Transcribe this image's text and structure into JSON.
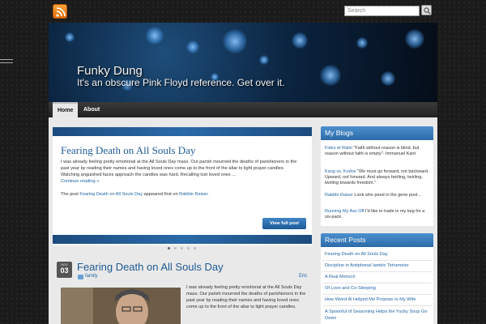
{
  "site": {
    "title": "Funky Dung",
    "tagline": "It's an obscure Pink Floyd reference. Get over it."
  },
  "search": {
    "placeholder": "Search"
  },
  "icons": {
    "rss": "rss-icon",
    "search": "search-icon",
    "category": "folder-icon"
  },
  "colors": {
    "accent": "#2a6aa8",
    "link": "#2467a8",
    "title": "#1f5b95"
  },
  "nav": {
    "items": [
      {
        "label": "Home"
      },
      {
        "label": "About"
      }
    ]
  },
  "featured": {
    "title": "Fearing Death on All Souls Day",
    "excerpt": "I was already feeling pretty emotional at the All Souls Day mass. Our parish mourned the deaths of parishioners in the past year by reading their names and having loved ones come up to the front of the altar to light prayer candles. Watching anguished faces approach the candles was hard. Recalling lost loved ones …",
    "continue_label": "Continue reading »",
    "posted_prefix": "The post ",
    "posted_link": "Fearing Death on All Souls Day",
    "posted_middle": " appeared first on ",
    "posted_site": "Rabble Raiser",
    "posted_suffix": ".",
    "button_label": "View full post",
    "slide_count": 5,
    "active_slide": 1
  },
  "post": {
    "month": "NOV",
    "day": "03",
    "title": "Fearing Death on All Souls Day",
    "category": "family",
    "author": "Eric",
    "body": "I was already feeling pretty emotional at the All Souls Day mass. Our parish mourned the deaths of parishioners in the past year by reading their names and having loved ones come up to the front of the altar to light prayer candles."
  },
  "my_blogs": {
    "heading": "My Blogs",
    "items": [
      {
        "name": "Fides et Ratio",
        "text": " \"Faith without reason is blind, but reason without faith is empty\"- Immanuel Kant"
      },
      {
        "name": "Kang vs. Kodos",
        "text": " \"We must go forward, not backward. Upward, not forward. And always twirling, twirling, twirling towards freedom.\""
      },
      {
        "name": "Rabble Raiser",
        "text": " Look who peed in the gene pool..."
      },
      {
        "name": "Running My Ass Off",
        "text": " I'd like to trade in my keg for a six-pack."
      }
    ]
  },
  "recent_posts": {
    "heading": "Recent Posts",
    "items": [
      "Fearing Death on All Souls Day",
      "Discipline in Antiphonal Iambic Tetrameter",
      "A Real Mensch",
      "Of Love and Co-Sleeping",
      "How Weird Al Helped Me Propose to My Wife",
      "A Spoonful of Seasoning Helps the Yucky Soup Go Down"
    ]
  }
}
